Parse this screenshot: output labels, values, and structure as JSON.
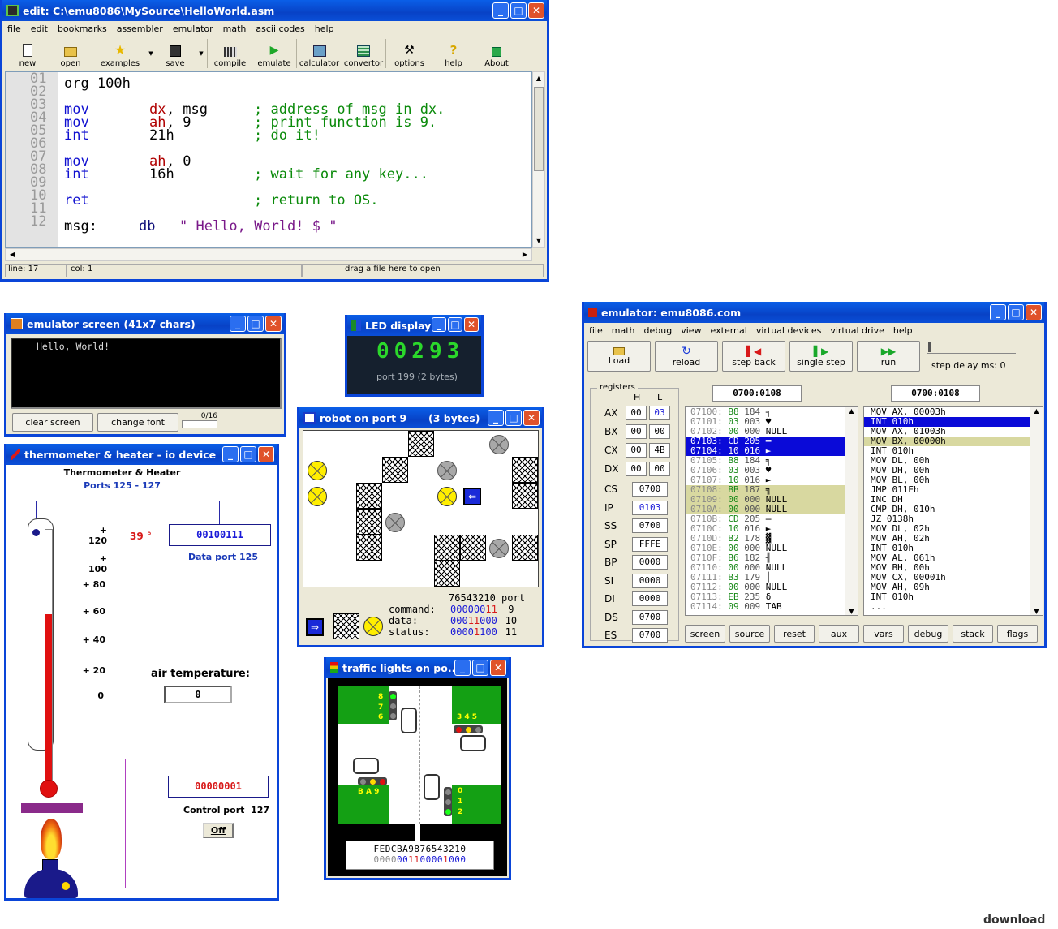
{
  "editor": {
    "title": "edit: C:\\emu8086\\MySource\\HelloWorld.asm",
    "menu": [
      "file",
      "edit",
      "bookmarks",
      "assembler",
      "emulator",
      "math",
      "ascii codes",
      "help"
    ],
    "toolbar": {
      "new": "new",
      "open": "open",
      "examples": "examples",
      "save": "save",
      "compile": "compile",
      "emulate": "emulate",
      "calculator": "calculator",
      "convertor": "convertor",
      "options": "options",
      "help": "help",
      "about": "About"
    },
    "line_numbers": [
      "01",
      "02",
      "03",
      "04",
      "05",
      "06",
      "07",
      "08",
      "09",
      "10",
      "11",
      "12"
    ],
    "code": {
      "org": "org 100h",
      "mov1": "mov",
      "dx": "dx",
      "c1": ",",
      "msg_arg": " msg",
      "cm1": "; address of msg in dx.",
      "mov2": "mov",
      "ah1": "ah",
      "c2": ",",
      "nine": " 9",
      "cm2": "; print function is 9.",
      "int1": "int",
      "h21": "21h",
      "cm3": "; do it!",
      "mov3": "mov",
      "ah2": "ah",
      "c3": ",",
      "zero": " 0",
      "int2": "int",
      "h16": "16h",
      "cm4": "; wait for any key...",
      "ret": "ret",
      "cm5": "; return to OS.",
      "msg_label": "msg:",
      "db": "db",
      "str": "\" Hello, World! $ \""
    },
    "status": {
      "line": "line: 17",
      "col": "col: 1",
      "hint": "drag a file here to open"
    }
  },
  "screen": {
    "title": "emulator screen (41x7 chars)",
    "text": "Hello, World!",
    "clear": "clear screen",
    "font": "change font",
    "counter": "0/16"
  },
  "led": {
    "title": "LED display",
    "value": "00293",
    "port": "port 199 (2 bytes)"
  },
  "robot": {
    "title": "robot on port 9",
    "bytes": "(3 bytes)",
    "header": "76543210 port",
    "rows": [
      {
        "label": "command:",
        "blue": "000000",
        "red": "11",
        "port": "9"
      },
      {
        "label": "data:",
        "blue": "000",
        "red": "11",
        "blue2": "000",
        "port": "10"
      },
      {
        "label": "status:",
        "blue": "0000",
        "red": "1",
        "blue2": "100",
        "port": "11"
      }
    ]
  },
  "thermo": {
    "title": "thermometer & heater - io device",
    "heading": "Thermometer & Heater",
    "ports": "Ports 125 - 127",
    "scale": [
      "+ 120",
      "+ 100",
      "+ 80",
      "+ 60",
      "+ 40",
      "+ 20",
      "0"
    ],
    "temp": "39 °",
    "data_value": "00100111",
    "data_label": "Data port 125",
    "air_label": "air temperature:",
    "air_value": "0",
    "control_value": "00000001",
    "control_label": "Control port  127",
    "off": "Off",
    "level": 0.66
  },
  "traffic": {
    "title": "traffic lights on po...",
    "nums_top_left": [
      "8",
      "7",
      "6"
    ],
    "nums_top_right": "3 4 5",
    "nums_bottom_left": "B A 9",
    "nums_bottom_right": [
      "0",
      "1",
      "2"
    ],
    "hex": "FEDCBA9876543210",
    "bits_gray": "0000",
    "bits_blue": "00",
    "bits_red": "11",
    "bits_blue2": "0000",
    "bits_red2": "1",
    "bits_blue3": "000"
  },
  "emu": {
    "title": "emulator: emu8086.com",
    "menu": [
      "file",
      "math",
      "debug",
      "view",
      "external",
      "virtual devices",
      "virtual drive",
      "help"
    ],
    "toolbar": {
      "load": "Load",
      "reload": "reload",
      "back": "step back",
      "single": "single step",
      "run": "run",
      "delay": "step delay ms: 0"
    },
    "registers_label": "registers",
    "h": "H",
    "l": "L",
    "addr1": "0700:0108",
    "addr2": "0700:0108",
    "regs": [
      {
        "n": "AX",
        "h": "00",
        "l": "03"
      },
      {
        "n": "BX",
        "h": "00",
        "l": "00"
      },
      {
        "n": "CX",
        "h": "00",
        "l": "4B"
      },
      {
        "n": "DX",
        "h": "00",
        "l": "00"
      }
    ],
    "regs16": [
      {
        "n": "CS",
        "v": "0700"
      },
      {
        "n": "IP",
        "v": "0103"
      },
      {
        "n": "SS",
        "v": "0700"
      },
      {
        "n": "SP",
        "v": "FFFE"
      },
      {
        "n": "BP",
        "v": "0000"
      },
      {
        "n": "SI",
        "v": "0000"
      },
      {
        "n": "DI",
        "v": "0000"
      },
      {
        "n": "DS",
        "v": "0700"
      },
      {
        "n": "ES",
        "v": "0700"
      }
    ],
    "mem": [
      [
        "07100:",
        "B8",
        "184",
        "╕"
      ],
      [
        "07101:",
        "03",
        "003",
        "♥"
      ],
      [
        "07102:",
        "00",
        "000",
        "NULL"
      ],
      [
        "07103:",
        "CD",
        "205",
        "═"
      ],
      [
        "07104:",
        "10",
        "016",
        "►"
      ],
      [
        "07105:",
        "B8",
        "184",
        "╕"
      ],
      [
        "07106:",
        "03",
        "003",
        "♥"
      ],
      [
        "07107:",
        "10",
        "016",
        "►"
      ],
      [
        "07108:",
        "BB",
        "187",
        "╗"
      ],
      [
        "07109:",
        "00",
        "000",
        "NULL"
      ],
      [
        "0710A:",
        "00",
        "000",
        "NULL"
      ],
      [
        "0710B:",
        "CD",
        "205",
        "═"
      ],
      [
        "0710C:",
        "10",
        "016",
        "►"
      ],
      [
        "0710D:",
        "B2",
        "178",
        "▓"
      ],
      [
        "0710E:",
        "00",
        "000",
        "NULL"
      ],
      [
        "0710F:",
        "B6",
        "182",
        "╢"
      ],
      [
        "07110:",
        "00",
        "000",
        "NULL"
      ],
      [
        "07111:",
        "B3",
        "179",
        "│"
      ],
      [
        "07112:",
        "00",
        "000",
        "NULL"
      ],
      [
        "07113:",
        "EB",
        "235",
        "δ"
      ],
      [
        "07114:",
        "09",
        "009",
        "TAB"
      ]
    ],
    "dis": [
      "MOV AX, 00003h",
      "INT 010h",
      "MOV AX, 01003h",
      "MOV BX, 00000h",
      "INT 010h",
      "MOV DL, 00h",
      "MOV DH, 00h",
      "MOV BL, 00h",
      "JMP 011Eh",
      "INC DH",
      "CMP DH, 010h",
      "JZ 0138h",
      "MOV DL, 02h",
      "MOV AH, 02h",
      "INT 010h",
      "MOV AL, 061h",
      "MOV BH, 00h",
      "MOV CX, 00001h",
      "MOV AH, 09h",
      "INT 010h",
      "..."
    ],
    "buttons": [
      "screen",
      "source",
      "reset",
      "aux",
      "vars",
      "debug",
      "stack",
      "flags"
    ]
  },
  "watermark": "download"
}
